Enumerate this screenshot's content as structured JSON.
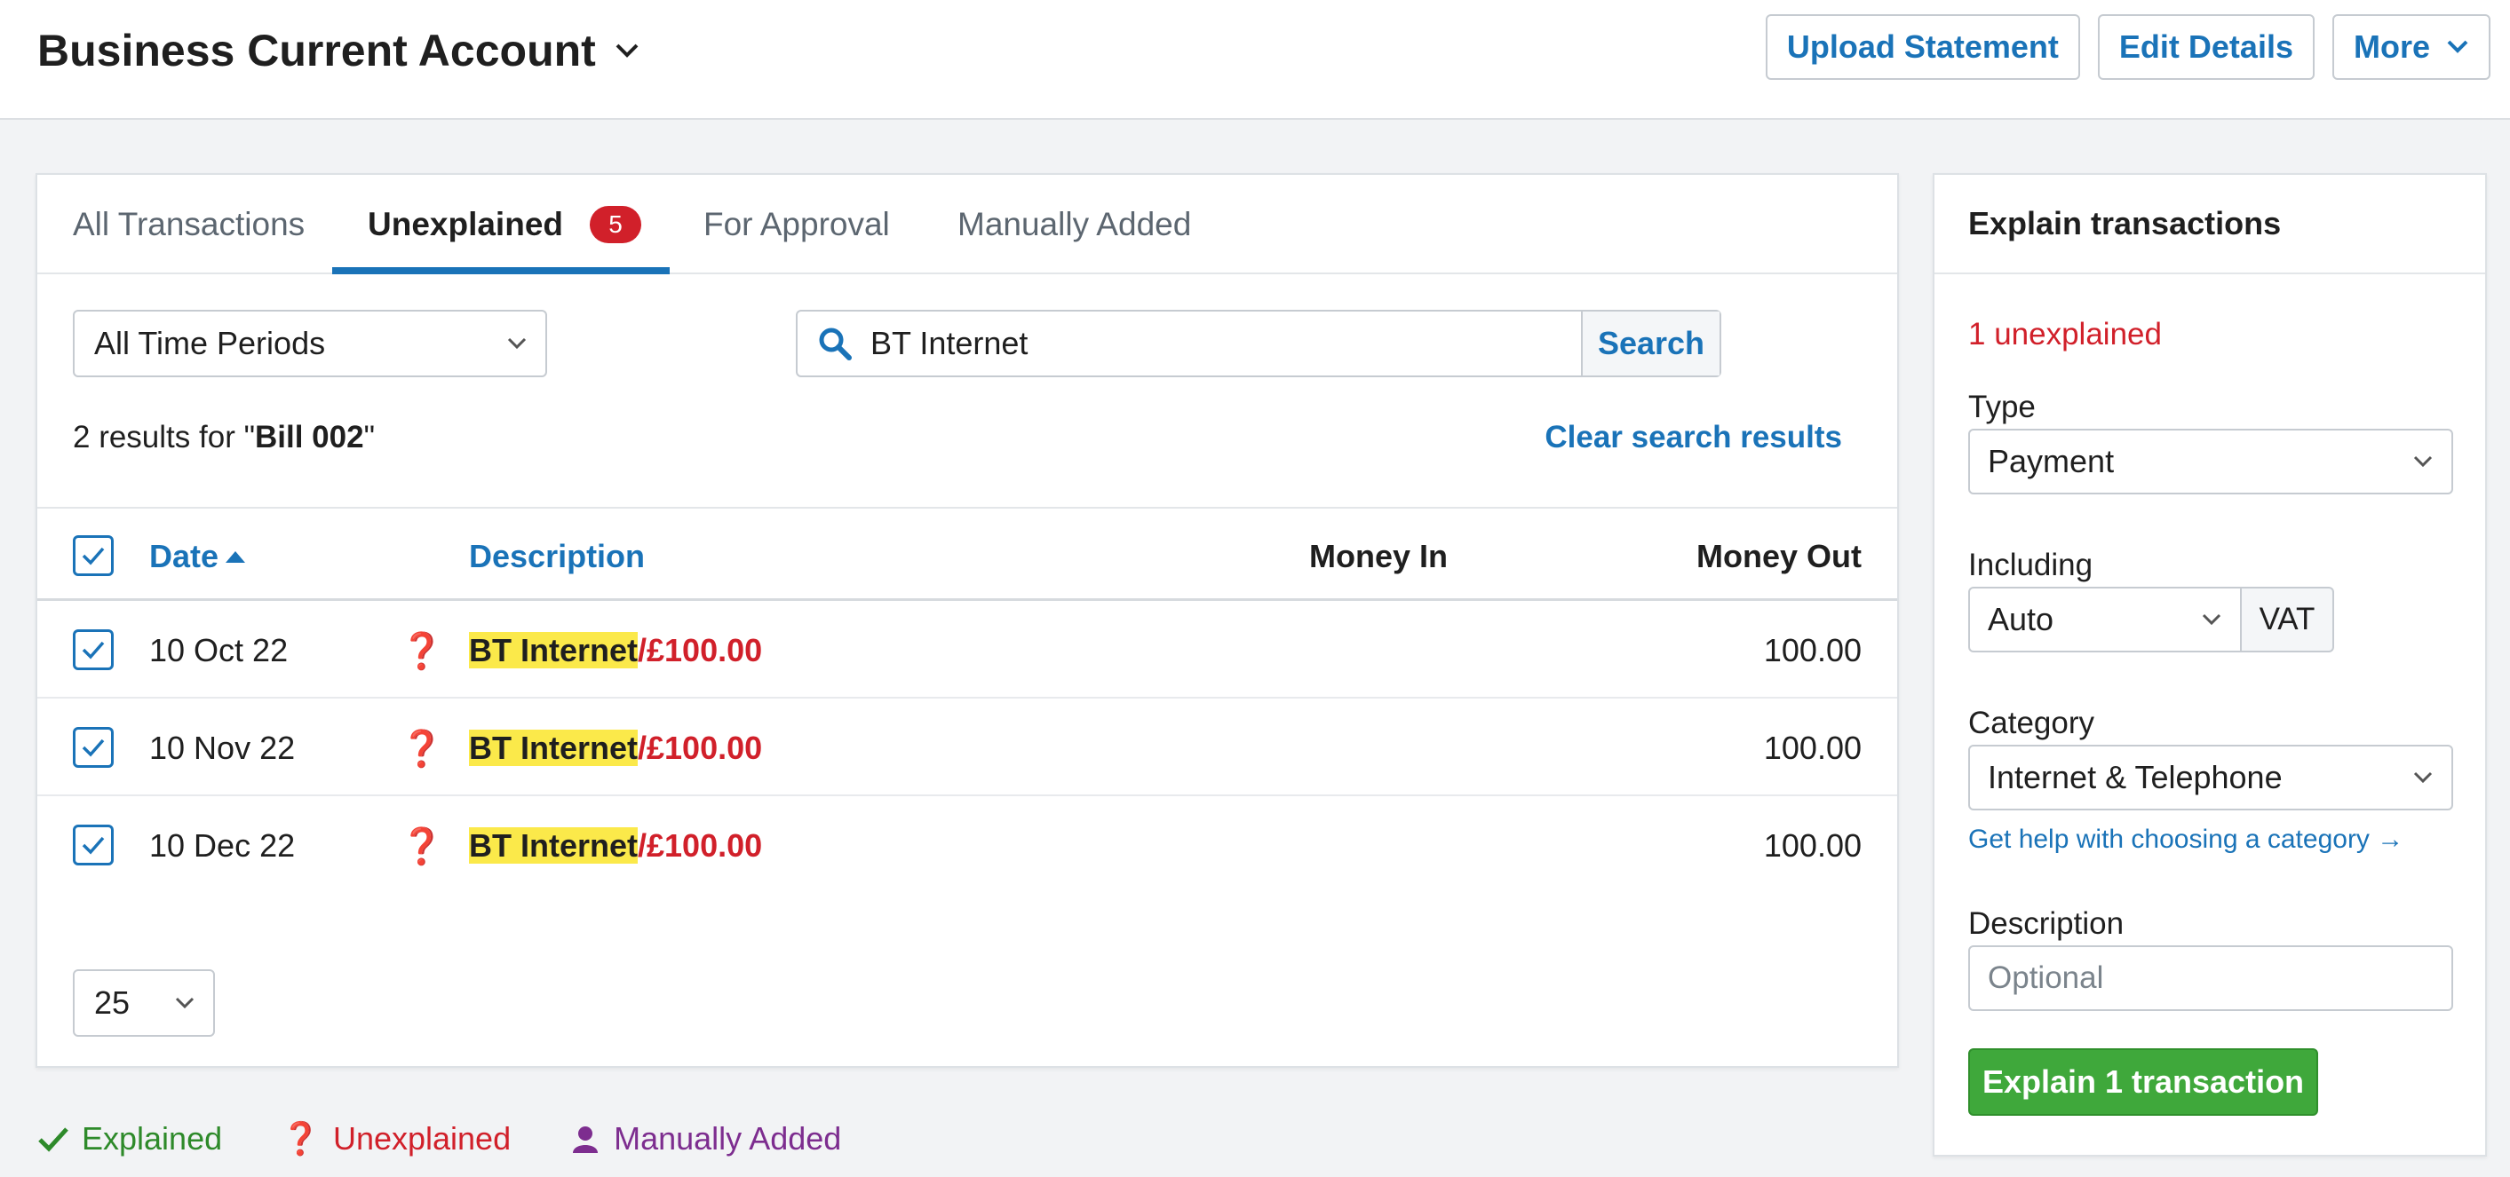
{
  "header": {
    "account_title": "Business Current Account",
    "buttons": {
      "upload": "Upload Statement",
      "edit": "Edit Details",
      "more": "More"
    }
  },
  "tabs": [
    {
      "label": "All Transactions"
    },
    {
      "label": "Unexplained",
      "badge": "5",
      "active": true
    },
    {
      "label": "For Approval"
    },
    {
      "label": "Manually Added"
    }
  ],
  "filters": {
    "period": "All Time Periods",
    "search_value": "BT Internet",
    "search_button": "Search"
  },
  "results": {
    "prefix": "2 results for \"",
    "term": "Bill 002",
    "suffix": "\"",
    "clear_label": "Clear search results"
  },
  "table": {
    "headers": {
      "date": "Date",
      "description": "Description",
      "money_in": "Money In",
      "money_out": "Money Out"
    },
    "rows": [
      {
        "date": "10 Oct 22",
        "status": "❓",
        "desc_highlight": "BT Internet",
        "desc_rest": "/£100.00",
        "money_in": "",
        "money_out": "100.00"
      },
      {
        "date": "10 Nov 22",
        "status": "❓",
        "desc_highlight": "BT Internet",
        "desc_rest": "/£100.00",
        "money_in": "",
        "money_out": "100.00"
      },
      {
        "date": "10 Dec 22",
        "status": "❓",
        "desc_highlight": "BT Internet",
        "desc_rest": "/£100.00",
        "money_in": "",
        "money_out": "100.00"
      }
    ],
    "per_page": "25"
  },
  "legend": {
    "explained": "Explained",
    "unexplained": "Unexplained",
    "manually_added": "Manually Added"
  },
  "sidebar": {
    "title": "Explain transactions",
    "unexplained_count": "1 unexplained",
    "type_label": "Type",
    "type_value": "Payment",
    "including_label": "Including",
    "including_value": "Auto",
    "vat_label": "VAT",
    "category_label": "Category",
    "category_value": "Internet & Telephone",
    "help_link": "Get help with choosing a category →",
    "description_label": "Description",
    "description_placeholder": "Optional",
    "explain_button": "Explain 1 transaction"
  },
  "colors": {
    "accent": "#1a73b8",
    "danger": "#d1202a",
    "success": "#3fa83b",
    "highlight": "#fbe94a",
    "manual": "#7d2d8f"
  }
}
